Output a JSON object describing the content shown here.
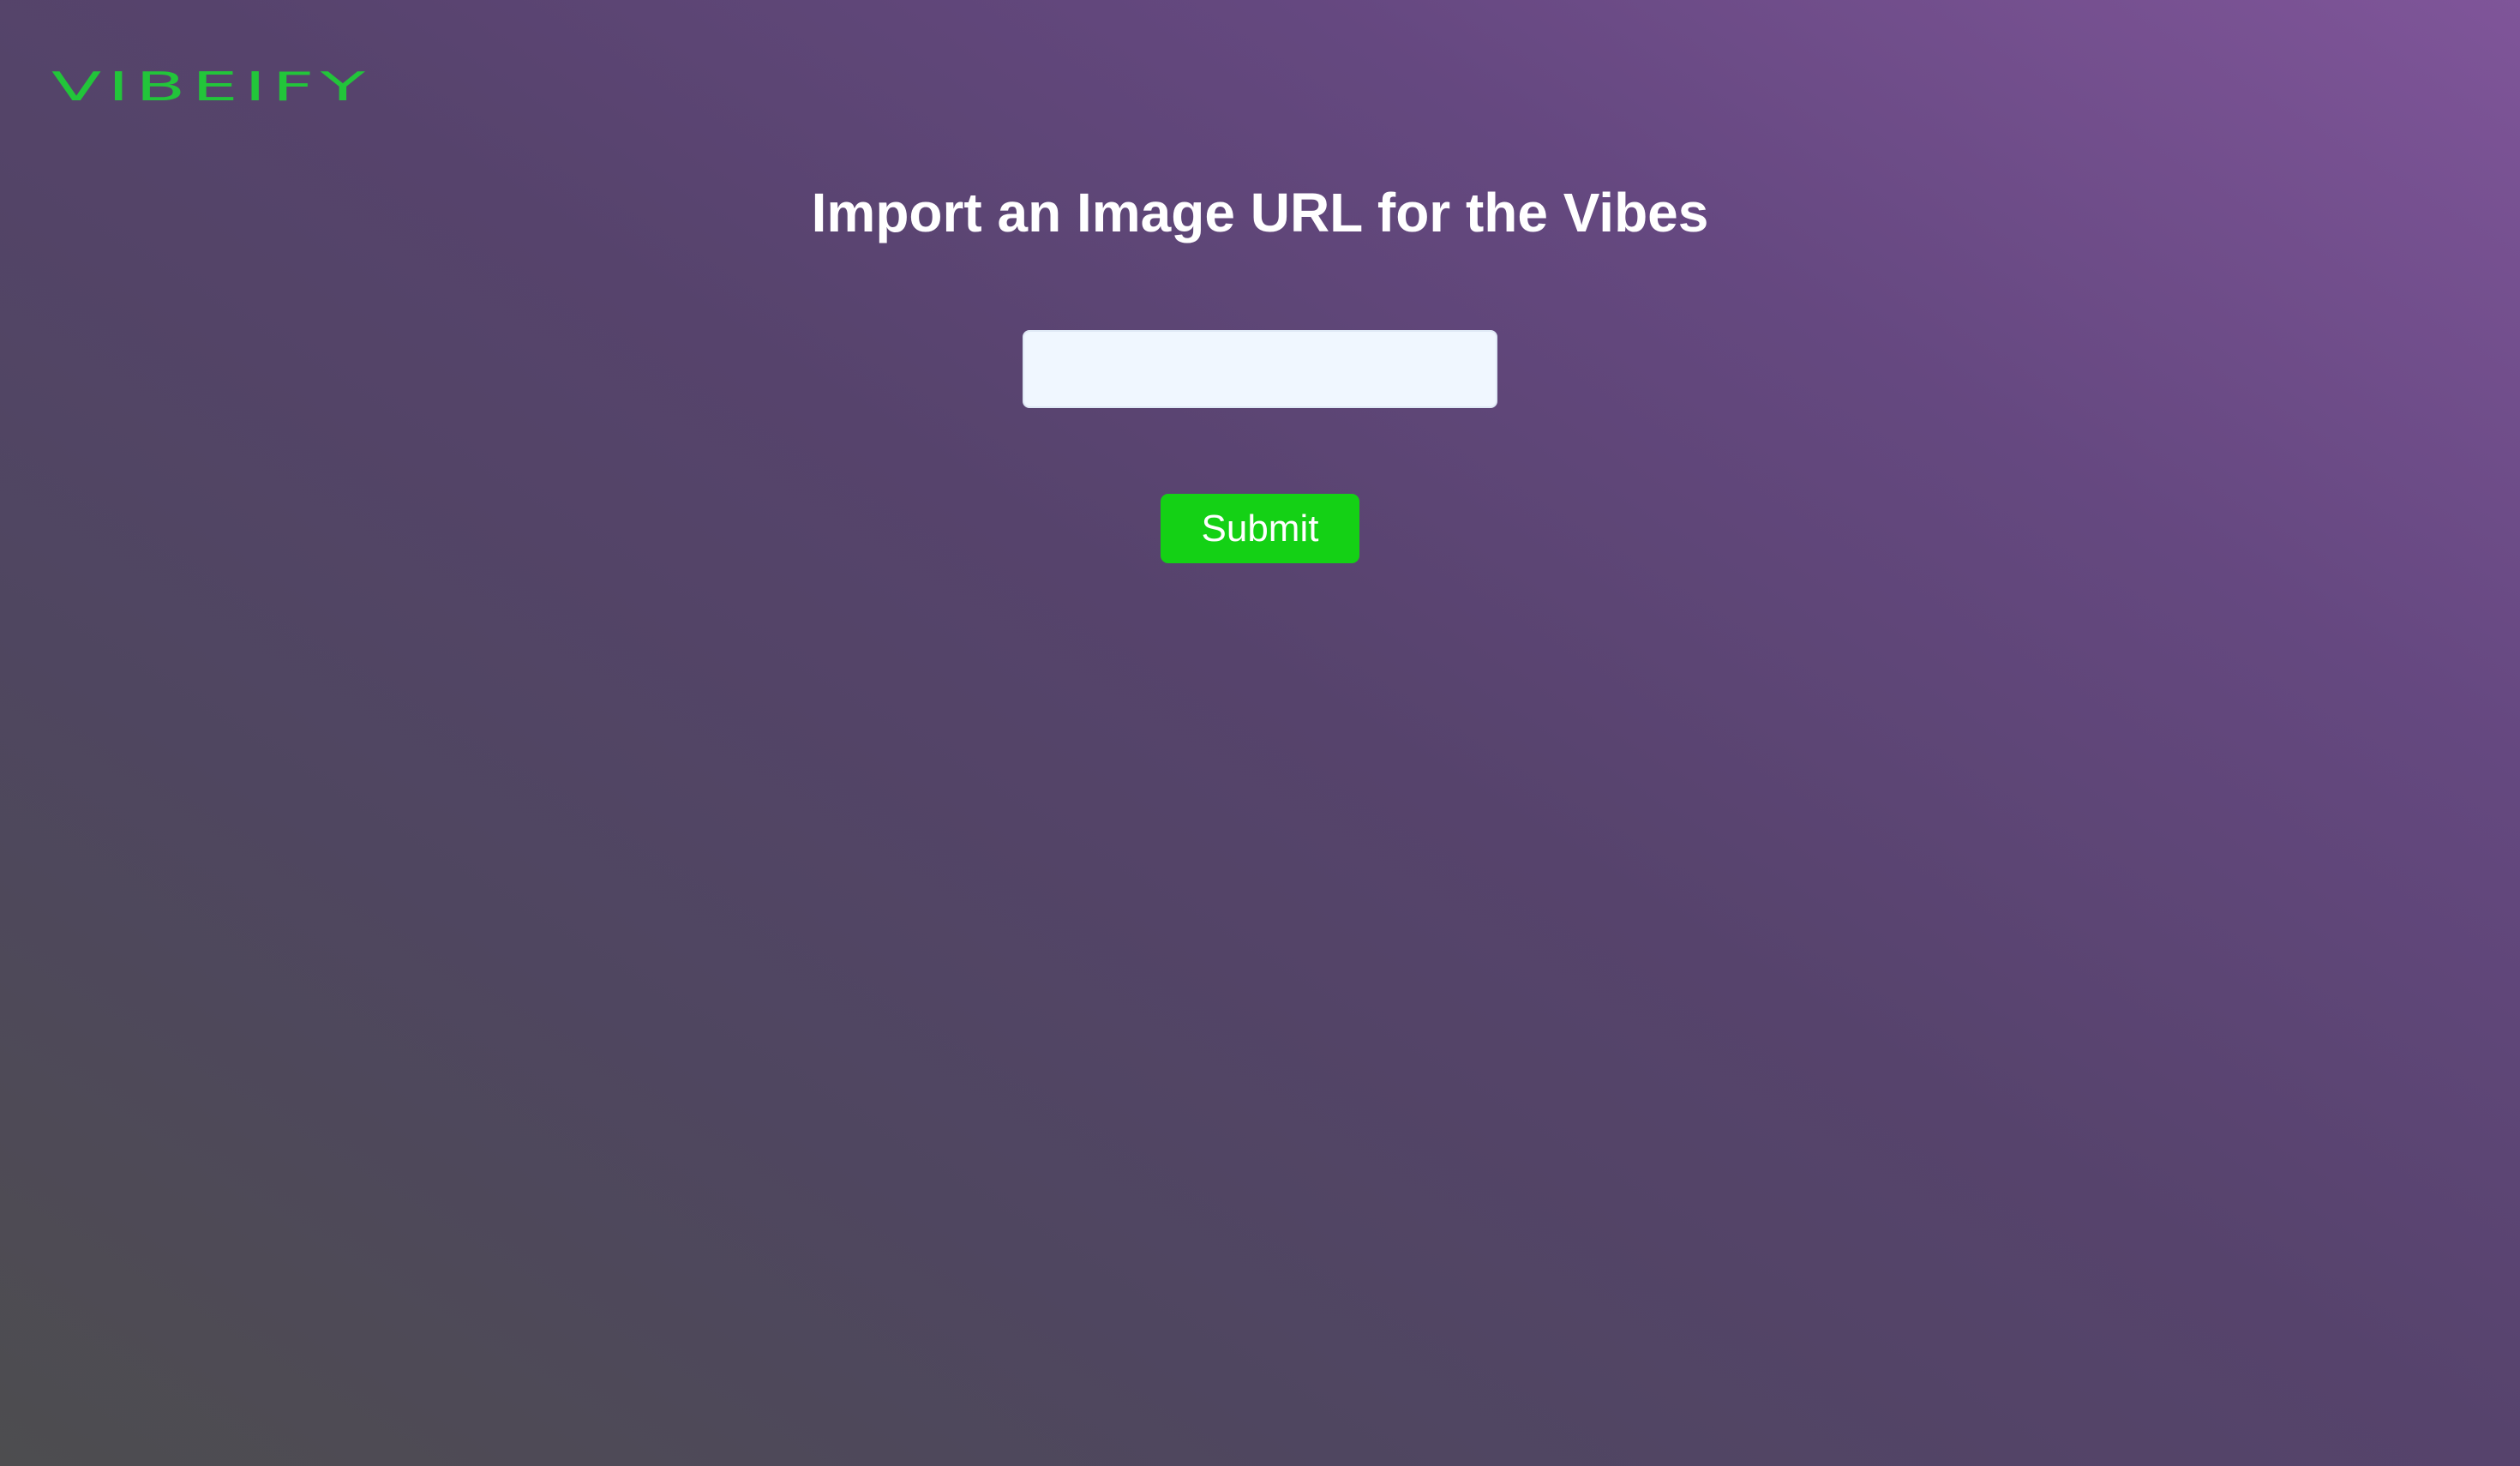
{
  "app": {
    "logo_text": "VIBEIFY"
  },
  "main": {
    "title": "Import an Image URL for the Vibes",
    "url_input": {
      "value": "",
      "placeholder": ""
    },
    "submit_label": "Submit"
  },
  "colors": {
    "brand": "#22c53a",
    "button": "#14d115",
    "input_bg": "#f0f7ff",
    "title_text": "#ffffff"
  }
}
